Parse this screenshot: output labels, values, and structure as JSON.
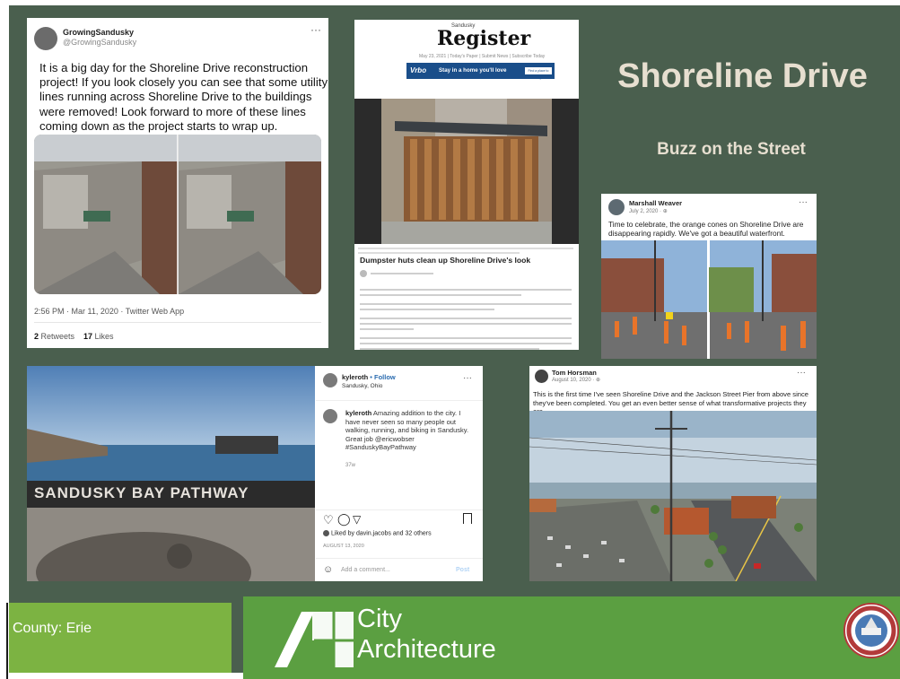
{
  "slide": {
    "title": "Shoreline Drive",
    "subtitle": "Buzz on the Street"
  },
  "tweet": {
    "name": "GrowingSandusky",
    "handle": "@GrowingSandusky",
    "menu": "···",
    "text": "It is a big day for the Shoreline Drive reconstruction project! If you look closely you can see that some utility lines running across Shoreline Drive to the buildings were removed! Look forward to more of these lines coming down as the project starts to wrap up.",
    "timestamp": "2:56 PM · Mar 11, 2020 · Twitter Web App",
    "retweets_count": "2",
    "retweets_label": "Retweets",
    "likes_count": "17",
    "likes_label": "Likes"
  },
  "article": {
    "brand_small": "Sandusky",
    "brand": "Register",
    "nav": "May 23, 2021 | Today's Paper | Submit News | Subscribe Today",
    "ad_brand": "Vrbo",
    "ad_text": "Stay in a home you'll love",
    "ad_button": "Find a place to stay",
    "headline": "Dumpster huts clean up Shoreline Drive's look"
  },
  "fb_post_1": {
    "name": "Marshall Weaver",
    "date": "July 2, 2020 · ⊕",
    "menu": "···",
    "text": "Time to celebrate, the orange cones on Shoreline Drive are disappearing rapidly. We've got a beautiful waterfront."
  },
  "instagram": {
    "username": "kyleroth",
    "follow": "• Follow",
    "location": "Sandusky, Ohio",
    "menu": "···",
    "caption_user": "kyleroth",
    "caption": "Amazing addition to the city. I have never seen so many people out walking, running, and biking in Sandusky. Great job @ericwobser #SanduskyBayPathway",
    "age": "37w",
    "liked_by": "Liked by davin.jacobs and 32 others",
    "date": "AUGUST 13, 2020",
    "comment_placeholder": "Add a comment...",
    "post_button": "Post",
    "sign_text": "SANDUSKY BAY PATHWAY"
  },
  "fb_post_2": {
    "name": "Tom Horsman",
    "date": "August 10, 2020 · ⊕",
    "menu": "···",
    "text": "This is the first time I've seen Shoreline Drive and the Jackson Street Pier from above since they've been completed. You get an even better sense of what transformative projects they are."
  },
  "footer": {
    "county": "County:  Erie",
    "logo_line1": "City",
    "logo_line2": "Architecture",
    "seal_top": "CITY OF SANDUSKY, OHIO",
    "seal_bottom": "FOUNDED 1818"
  },
  "colors": {
    "slide_bg": "#4a5f4e",
    "title": "#e7dfd0",
    "footer_green": "#5b9f41",
    "footer_lightgreen": "#7cb342",
    "link_blue": "#2b6cb0",
    "cone_orange": "#e8742a"
  }
}
